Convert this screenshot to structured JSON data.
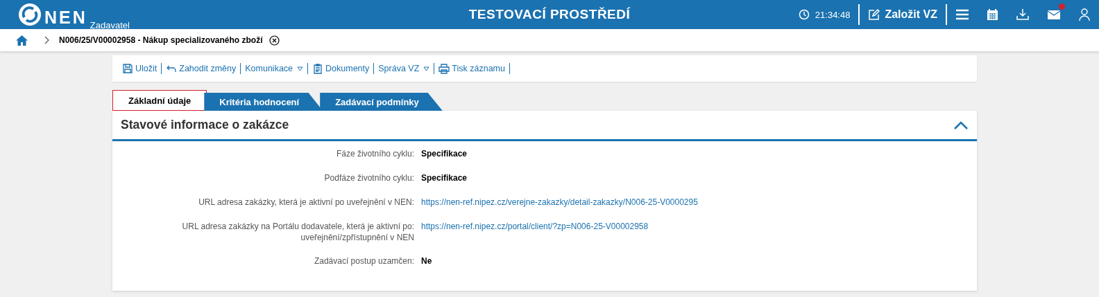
{
  "header": {
    "logo": "NEN",
    "subtitle": "Zadavatel",
    "environment": "TESTOVACÍ PROSTŘEDÍ",
    "time": "21:34:48",
    "create_button": "Založit VZ",
    "mail_unread": true
  },
  "breadcrumb": {
    "item": "N006/25/V00002958 - Nákup specializovaného zboží"
  },
  "toolbar": [
    {
      "label": "Uložit",
      "kind": "save",
      "dropdown": false
    },
    {
      "label": "Zahodit změny",
      "kind": "undo",
      "dropdown": false
    },
    {
      "label": "Komunikace",
      "kind": "menu",
      "dropdown": true
    },
    {
      "label": "Dokumenty",
      "kind": "documents",
      "dropdown": false
    },
    {
      "label": "Správa VZ",
      "kind": "menu",
      "dropdown": true
    },
    {
      "label": "Tisk záznamu",
      "kind": "print",
      "dropdown": false
    }
  ],
  "tabs": [
    {
      "label": "Základní údaje",
      "selected": true
    },
    {
      "label": "Kritéria hodnocení",
      "selected": false
    },
    {
      "label": "Zadávací podmínky",
      "selected": false
    }
  ],
  "panel": {
    "title": "Stavové informace o zakázce",
    "expanded": true,
    "fields": [
      {
        "label": "Fáze životního cyklu:",
        "value": "Specifikace",
        "kind": "text"
      },
      {
        "label": "Podfáze životního cyklu:",
        "value": "Specifikace",
        "kind": "text"
      },
      {
        "label": "URL adresa zakázky, která je aktivní po uveřejnění v NEN:",
        "value": "https://nen-ref.nipez.cz/verejne-zakazky/detail-zakazky/N006-25-V0000295",
        "kind": "link"
      },
      {
        "label": "URL adresa zakázky na Portálu dodavatele, která je aktivní po: uveřejnění/zpřístupnění v NEN",
        "value": "https://nen-ref.nipez.cz/portal/client/?zp=N006-25-V00002958",
        "kind": "link"
      },
      {
        "label": "Zadávací postup uzamčen:",
        "value": "Ne",
        "kind": "text"
      }
    ]
  }
}
